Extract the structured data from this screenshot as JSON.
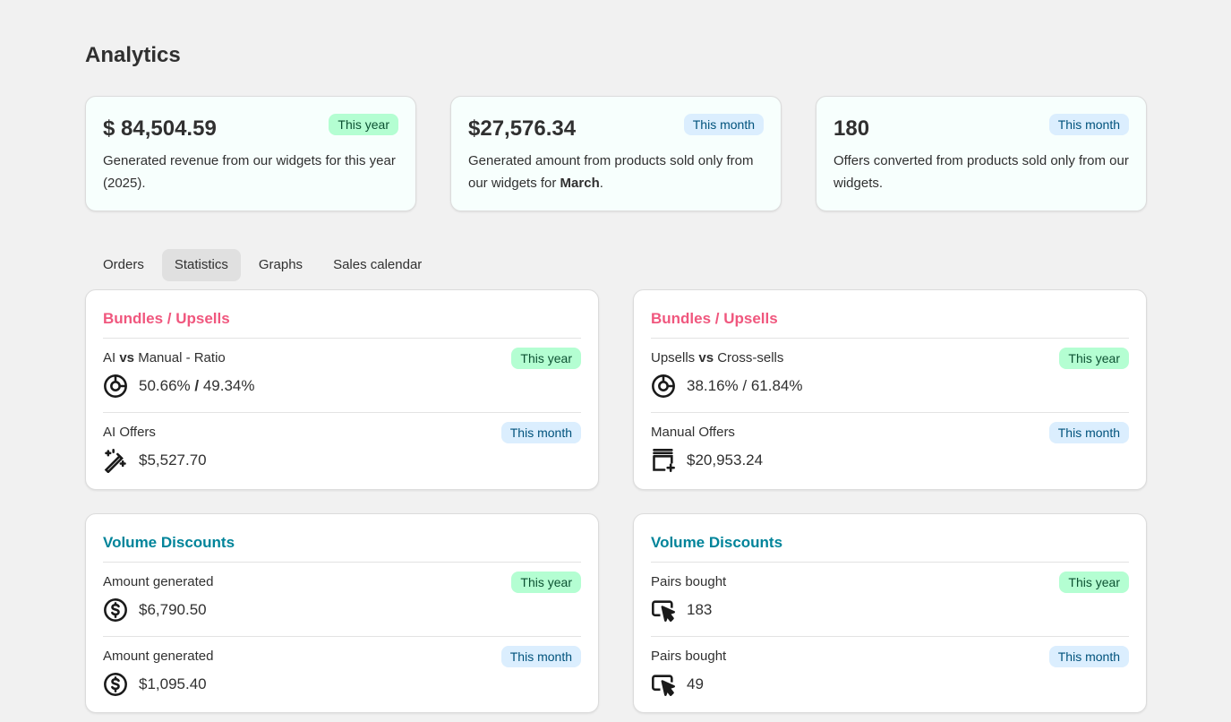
{
  "page": {
    "title": "Analytics"
  },
  "summary_cards": [
    {
      "value": "$ 84,504.59",
      "badge": "This year",
      "desc": "Generated revenue from our widgets for this year (2025)."
    },
    {
      "value": "$27,576.34",
      "badge": "This month",
      "desc_prefix": "Generated amount from products sold only from our widgets for ",
      "desc_bold": "March",
      "desc_suffix": "."
    },
    {
      "value": "180",
      "badge": "This month",
      "desc": "Offers converted from products sold only from our widgets."
    }
  ],
  "tabs": [
    {
      "label": "Orders"
    },
    {
      "label": "Statistics"
    },
    {
      "label": "Graphs"
    },
    {
      "label": "Sales calendar"
    }
  ],
  "panels": {
    "bundles_left": {
      "title": "Bundles / Upsells",
      "row1": {
        "label_a": "AI ",
        "label_bold": "vs",
        "label_b": " Manual - Ratio",
        "badge": "This year",
        "value_a": "50.66% ",
        "value_sep": "/",
        "value_b": " 49.34%",
        "icon": "pie-chart-icon"
      },
      "row2": {
        "label": "AI Offers",
        "badge": "This month",
        "value": "$5,527.70",
        "icon": "magic-wand-icon"
      }
    },
    "bundles_right": {
      "title": "Bundles / Upsells",
      "row1": {
        "label_a": "Upsells ",
        "label_bold": "vs",
        "label_b": " Cross-sells",
        "badge": "This year",
        "value": "38.16% / 61.84%",
        "icon": "pie-chart-icon"
      },
      "row2": {
        "label": "Manual Offers",
        "badge": "This month",
        "value": "$20,953.24",
        "icon": "product-add-icon"
      }
    },
    "volume_left": {
      "title": "Volume Discounts",
      "row1": {
        "label": "Amount generated",
        "badge": "This year",
        "value": "$6,790.50",
        "icon": "dollar-circle-icon"
      },
      "row2": {
        "label": "Amount generated",
        "badge": "This month",
        "value": "$1,095.40",
        "icon": "dollar-circle-icon"
      }
    },
    "volume_right": {
      "title": "Volume Discounts",
      "row1": {
        "label": "Pairs bought",
        "badge": "This year",
        "value": "183",
        "icon": "cursor-click-icon"
      },
      "row2": {
        "label": "Pairs bought",
        "badge": "This month",
        "value": "49",
        "icon": "cursor-click-icon"
      }
    }
  },
  "colors": {
    "badge_year_bg": "#b4fed2",
    "badge_month_bg": "#dbeefe",
    "title_pink": "#f0577e",
    "title_teal": "#00849a"
  }
}
